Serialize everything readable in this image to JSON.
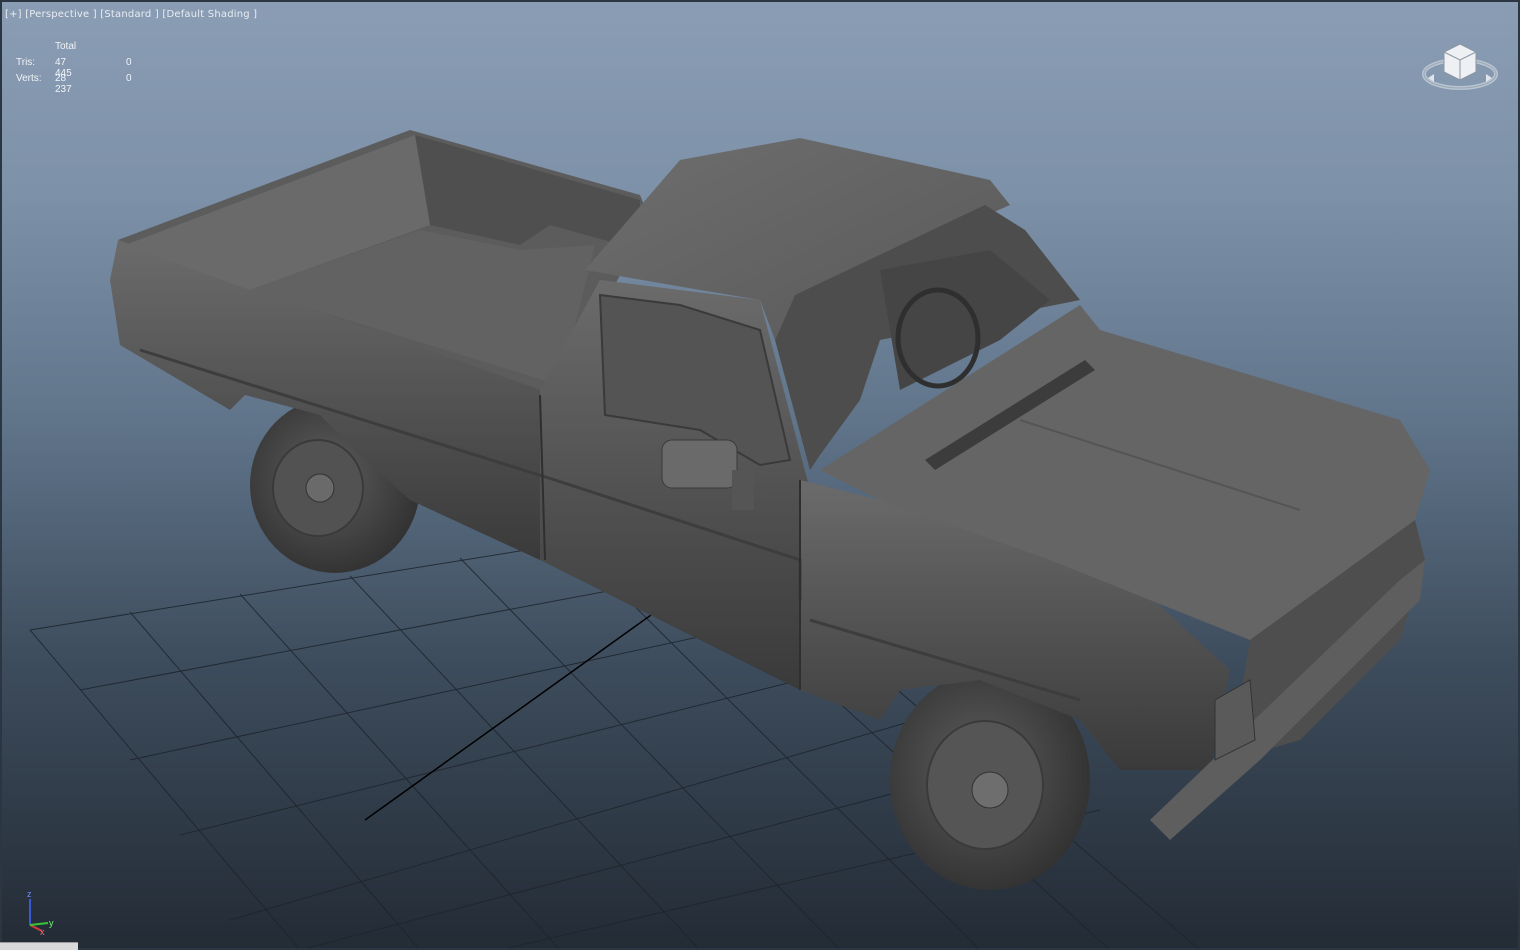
{
  "viewport": {
    "labels": {
      "menu": "[+]",
      "view": "[Perspective ]",
      "mode": "[Standard ]",
      "shading": "[Default Shading ]"
    },
    "stats": {
      "header": "Total",
      "rows": [
        {
          "label": "Tris:",
          "total": "47 445",
          "selected": "0"
        },
        {
          "label": "Verts:",
          "total": "28 237",
          "selected": "0"
        }
      ]
    },
    "model": "pickup-truck",
    "axis_labels": {
      "z": "z",
      "x": "x",
      "y": "y"
    }
  },
  "colors": {
    "background_top": "#8a9db4",
    "background_bottom": "#232b35",
    "grid": "#1c232b",
    "model": "#5a5a5a",
    "axis_x": "#d43a3a",
    "axis_y": "#3ac43a",
    "axis_z": "#3a5ad4"
  },
  "icons": {
    "viewcube": "viewcube-icon",
    "axis": "axis-tripod-icon"
  }
}
